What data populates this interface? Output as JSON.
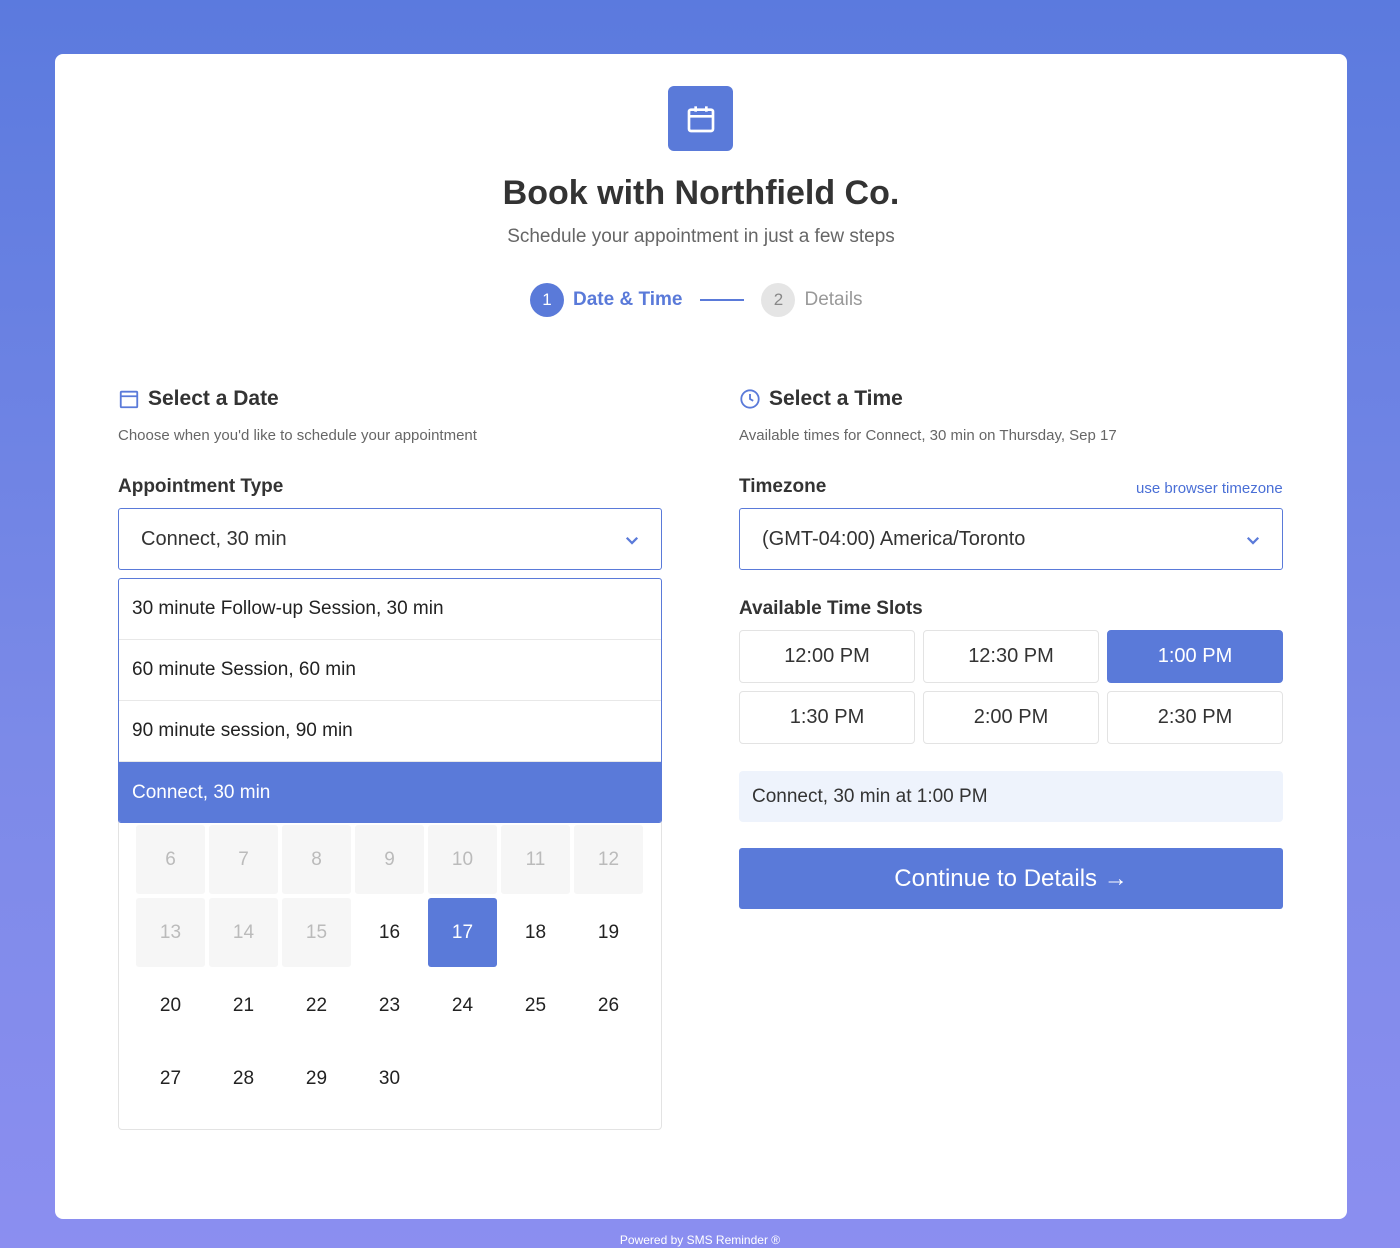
{
  "header": {
    "icon": "calendar-icon",
    "title": "Book with Northfield Co.",
    "subtitle": "Schedule your appointment in just a few steps"
  },
  "steps": [
    {
      "number": "1",
      "label": "Date & Time",
      "active": true
    },
    {
      "number": "2",
      "label": "Details",
      "active": false
    }
  ],
  "date_section": {
    "title": "Select a Date",
    "description": "Choose when you'd like to schedule your appointment",
    "appointment_type_label": "Appointment Type",
    "appointment_type_value": "Connect, 30 min",
    "options": [
      "30 minute Follow-up Session, 30 min",
      "60 minute Session, 60 min",
      "90 minute session, 90 min",
      "Connect, 30 min"
    ],
    "selected_option_index": 3,
    "calendar_rows": [
      [
        "6",
        "7",
        "8",
        "9",
        "10",
        "11",
        "12"
      ],
      [
        "13",
        "14",
        "15",
        "16",
        "17",
        "18",
        "19"
      ],
      [
        "20",
        "21",
        "22",
        "23",
        "24",
        "25",
        "26"
      ],
      [
        "27",
        "28",
        "29",
        "30"
      ]
    ],
    "disabled_days": [
      "6",
      "7",
      "8",
      "9",
      "10",
      "11",
      "12",
      "13",
      "14",
      "15"
    ],
    "selected_day": "17"
  },
  "time_section": {
    "title": "Select a Time",
    "description": "Available times for Connect, 30 min on Thursday, Sep 17",
    "timezone_label": "Timezone",
    "timezone_link": "use browser timezone",
    "timezone_value": "(GMT-04:00) America/Toronto",
    "slots_label": "Available Time Slots",
    "slots": [
      "12:00 PM",
      "12:30 PM",
      "1:00 PM",
      "1:30 PM",
      "2:00 PM",
      "2:30 PM"
    ],
    "selected_slot": "1:00 PM",
    "summary": "Connect, 30 min at 1:00 PM",
    "continue_label": "Continue to Details →"
  },
  "footer": {
    "text": "Powered by SMS Reminder ®"
  },
  "colors": {
    "accent": "#5a7ad9",
    "background_top": "#5b7ade",
    "background_bottom": "#8b8ef0"
  }
}
